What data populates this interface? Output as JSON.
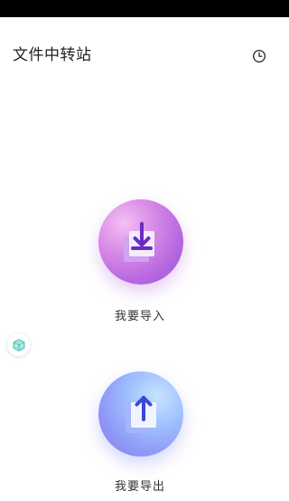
{
  "header": {
    "title": "文件中转站",
    "history_icon": "clock-icon"
  },
  "actions": {
    "import": {
      "label": "我要导入",
      "icon": "download-icon",
      "color_light": "#f4c0f5",
      "color_dark": "#9c58d9"
    },
    "export": {
      "label": "我要导出",
      "icon": "upload-icon",
      "color_light": "#c7e4ff",
      "color_dark": "#8b7ff0"
    }
  },
  "floating_widget": {
    "icon": "cube-icon",
    "color": "#6fd3c8"
  }
}
